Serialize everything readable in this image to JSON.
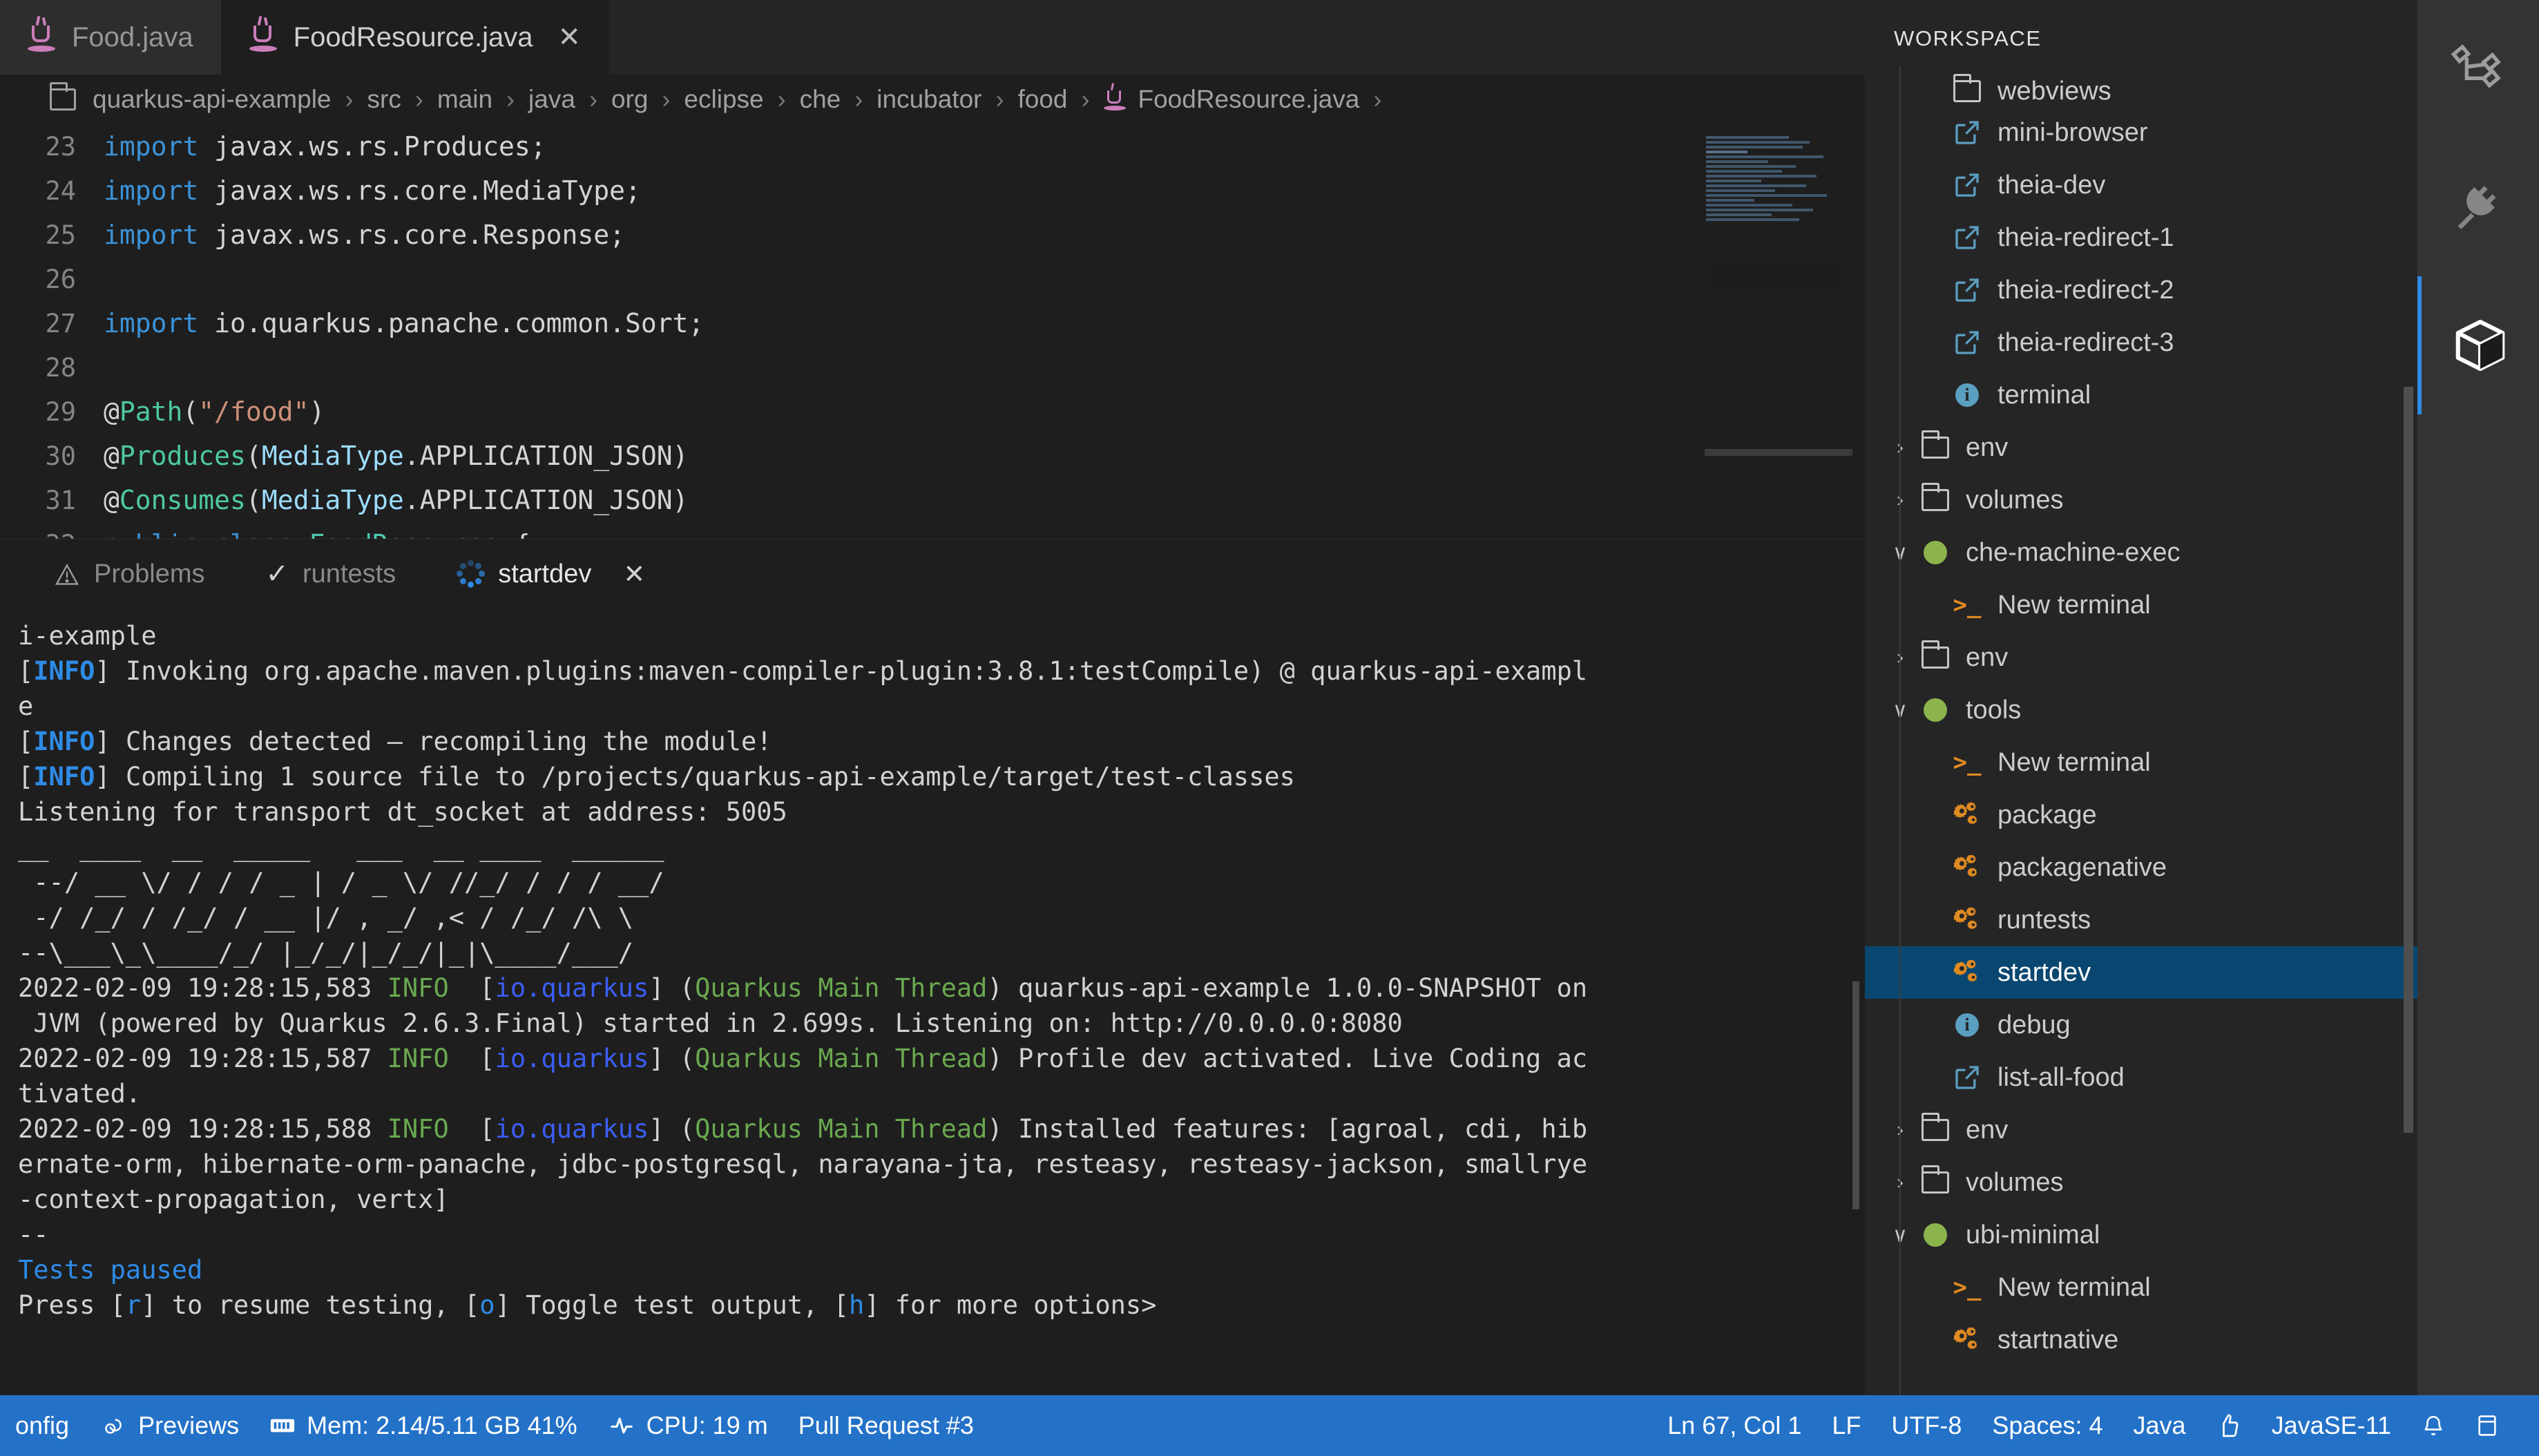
{
  "editor": {
    "tabs": [
      {
        "label": "Food.java",
        "icon": "java-icon",
        "active": false,
        "closable": false
      },
      {
        "label": "FoodResource.java",
        "icon": "java-icon",
        "active": true,
        "closable": true,
        "close_glyph": "✕"
      }
    ],
    "breadcrumb": {
      "folder_icon": "folder-icon",
      "separator": "›",
      "items": [
        "quarkus-api-example",
        "src",
        "main",
        "java",
        "org",
        "eclipse",
        "che",
        "incubator",
        "food"
      ],
      "file": "FoodResource.java",
      "file_icon": "java-icon",
      "trailing_separator": "›"
    },
    "code_lines": [
      {
        "num": "23",
        "tokens": [
          {
            "t": "import ",
            "c": "kw"
          },
          {
            "t": "javax.ws.rs.Produces;",
            "c": "plain"
          }
        ]
      },
      {
        "num": "24",
        "tokens": [
          {
            "t": "import ",
            "c": "kw"
          },
          {
            "t": "javax.ws.rs.core.MediaType;",
            "c": "plain"
          }
        ]
      },
      {
        "num": "25",
        "tokens": [
          {
            "t": "import ",
            "c": "kw"
          },
          {
            "t": "javax.ws.rs.core.Response;",
            "c": "plain"
          }
        ]
      },
      {
        "num": "26",
        "tokens": []
      },
      {
        "num": "27",
        "tokens": [
          {
            "t": "import ",
            "c": "kw"
          },
          {
            "t": "io.quarkus.panache.common.Sort;",
            "c": "plain"
          }
        ]
      },
      {
        "num": "28",
        "tokens": []
      },
      {
        "num": "29",
        "tokens": [
          {
            "t": "@",
            "c": "plain"
          },
          {
            "t": "Path",
            "c": "ann"
          },
          {
            "t": "(",
            "c": "plain"
          },
          {
            "t": "\"/food\"",
            "c": "str"
          },
          {
            "t": ")",
            "c": "plain"
          }
        ]
      },
      {
        "num": "30",
        "tokens": [
          {
            "t": "@",
            "c": "plain"
          },
          {
            "t": "Produces",
            "c": "ann"
          },
          {
            "t": "(",
            "c": "plain"
          },
          {
            "t": "MediaType",
            "c": "typ"
          },
          {
            "t": ".APPLICATION_JSON)",
            "c": "plain"
          }
        ]
      },
      {
        "num": "31",
        "tokens": [
          {
            "t": "@",
            "c": "plain"
          },
          {
            "t": "Consumes",
            "c": "ann"
          },
          {
            "t": "(",
            "c": "plain"
          },
          {
            "t": "MediaType",
            "c": "typ"
          },
          {
            "t": ".APPLICATION_JSON)",
            "c": "plain"
          }
        ]
      },
      {
        "num": "32",
        "tokens": [
          {
            "t": "public class ",
            "c": "kw"
          },
          {
            "t": "FoodResource",
            "c": "cls"
          },
          {
            "t": " {",
            "c": "plain"
          }
        ]
      }
    ]
  },
  "panel": {
    "tabs": [
      {
        "label": "Problems",
        "icon": "warning-triangle-icon",
        "selected": false
      },
      {
        "label": "runtests",
        "icon": "check-icon",
        "selected": false
      },
      {
        "label": "startdev",
        "icon": "spinner-icon",
        "selected": true,
        "close_glyph": "✕"
      }
    ],
    "terminal_lines": [
      [
        {
          "t": "i-example",
          "c": "plain"
        }
      ],
      [
        {
          "t": "[",
          "c": "plain"
        },
        {
          "t": "INFO",
          "c": "info"
        },
        {
          "t": "] Invoking org.apache.maven.plugins:maven-compiler-plugin:3.8.1:testCompile) @ quarkus-api-exampl",
          "c": "plain"
        }
      ],
      [
        {
          "t": "e",
          "c": "plain"
        }
      ],
      [
        {
          "t": "[",
          "c": "plain"
        },
        {
          "t": "INFO",
          "c": "info"
        },
        {
          "t": "] Changes detected – recompiling the module!",
          "c": "plain"
        }
      ],
      [
        {
          "t": "[",
          "c": "plain"
        },
        {
          "t": "INFO",
          "c": "info"
        },
        {
          "t": "] Compiling 1 source file to /projects/quarkus-api-example/target/test-classes",
          "c": "plain"
        }
      ],
      [
        {
          "t": "Listening for transport dt_socket at address: 5005",
          "c": "plain"
        }
      ],
      [
        {
          "t": "__  ____  __  _____   ___  __ ____  ______ ",
          "c": "plain"
        }
      ],
      [
        {
          "t": " --/ __ \\/ / / / _ | / _ \\/ //_/ / / / __/ ",
          "c": "plain"
        }
      ],
      [
        {
          "t": " -/ /_/ / /_/ / __ |/ , _/ ,< / /_/ /\\ \\   ",
          "c": "plain"
        }
      ],
      [
        {
          "t": "--\\___\\_\\____/_/ |_/_/|_/_/|_|\\____/___/   ",
          "c": "plain"
        }
      ],
      [
        {
          "t": "2022-02-09 19:28:15,583 ",
          "c": "plain"
        },
        {
          "t": "INFO",
          "c": "green"
        },
        {
          "t": "  [",
          "c": "plain"
        },
        {
          "t": "io.quarkus",
          "c": "blue"
        },
        {
          "t": "] (",
          "c": "plain"
        },
        {
          "t": "Quarkus Main Thread",
          "c": "green"
        },
        {
          "t": ") quarkus-api-example 1.0.0-SNAPSHOT on",
          "c": "plain"
        }
      ],
      [
        {
          "t": " JVM (powered by Quarkus 2.6.3.Final) started in 2.699s. Listening on: http://0.0.0.0:8080",
          "c": "plain"
        }
      ],
      [
        {
          "t": "",
          "c": "plain"
        }
      ],
      [
        {
          "t": "2022-02-09 19:28:15,587 ",
          "c": "plain"
        },
        {
          "t": "INFO",
          "c": "green"
        },
        {
          "t": "  [",
          "c": "plain"
        },
        {
          "t": "io.quarkus",
          "c": "blue"
        },
        {
          "t": "] (",
          "c": "plain"
        },
        {
          "t": "Quarkus Main Thread",
          "c": "green"
        },
        {
          "t": ") Profile dev activated. Live Coding ac",
          "c": "plain"
        }
      ],
      [
        {
          "t": "tivated.",
          "c": "plain"
        }
      ],
      [
        {
          "t": "2022-02-09 19:28:15,588 ",
          "c": "plain"
        },
        {
          "t": "INFO",
          "c": "green"
        },
        {
          "t": "  [",
          "c": "plain"
        },
        {
          "t": "io.quarkus",
          "c": "blue"
        },
        {
          "t": "] (",
          "c": "plain"
        },
        {
          "t": "Quarkus Main Thread",
          "c": "green"
        },
        {
          "t": ") Installed features: [agroal, cdi, hib",
          "c": "plain"
        }
      ],
      [
        {
          "t": "ernate-orm, hibernate-orm-panache, jdbc-postgresql, narayana-jta, resteasy, resteasy-jackson, smallrye",
          "c": "plain"
        }
      ],
      [
        {
          "t": "-context-propagation, vertx]",
          "c": "plain"
        }
      ],
      [
        {
          "t": "",
          "c": "plain"
        }
      ],
      [
        {
          "t": "--",
          "c": "plain"
        }
      ],
      [
        {
          "t": "Tests paused",
          "c": "ltblue"
        }
      ],
      [
        {
          "t": "Press [",
          "c": "plain"
        },
        {
          "t": "r",
          "c": "ltblue"
        },
        {
          "t": "] to resume testing, [",
          "c": "plain"
        },
        {
          "t": "o",
          "c": "ltblue"
        },
        {
          "t": "] Toggle test output, [",
          "c": "plain"
        },
        {
          "t": "h",
          "c": "ltblue"
        },
        {
          "t": "] for more options>",
          "c": "plain"
        }
      ]
    ]
  },
  "sidebar": {
    "title": "WORKSPACE",
    "items": [
      {
        "label": "webviews",
        "icon": "folder-icon",
        "indent": 2,
        "chevron": "",
        "clipped": true
      },
      {
        "label": "mini-browser",
        "icon": "link-icon",
        "indent": 2,
        "chevron": ""
      },
      {
        "label": "theia-dev",
        "icon": "link-icon",
        "indent": 2,
        "chevron": ""
      },
      {
        "label": "theia-redirect-1",
        "icon": "link-icon",
        "indent": 2,
        "chevron": ""
      },
      {
        "label": "theia-redirect-2",
        "icon": "link-icon",
        "indent": 2,
        "chevron": ""
      },
      {
        "label": "theia-redirect-3",
        "icon": "link-icon",
        "indent": 2,
        "chevron": ""
      },
      {
        "label": "terminal",
        "icon": "info-icon",
        "indent": 2,
        "chevron": ""
      },
      {
        "label": "env",
        "icon": "folder-icon",
        "indent": 1,
        "chevron": "›"
      },
      {
        "label": "volumes",
        "icon": "folder-icon",
        "indent": 1,
        "chevron": "›"
      },
      {
        "label": "che-machine-exec",
        "icon": "status-dot-green",
        "indent": 0,
        "chevron": "∨"
      },
      {
        "label": "New terminal",
        "icon": "terminal-icon",
        "indent": 2,
        "chevron": ""
      },
      {
        "label": "env",
        "icon": "folder-icon",
        "indent": 1,
        "chevron": "›"
      },
      {
        "label": "tools",
        "icon": "status-dot-green",
        "indent": 0,
        "chevron": "∨"
      },
      {
        "label": "New terminal",
        "icon": "terminal-icon",
        "indent": 2,
        "chevron": ""
      },
      {
        "label": "package",
        "icon": "gears-icon",
        "indent": 2,
        "chevron": ""
      },
      {
        "label": "packagenative",
        "icon": "gears-icon",
        "indent": 2,
        "chevron": ""
      },
      {
        "label": "runtests",
        "icon": "gears-icon",
        "indent": 2,
        "chevron": ""
      },
      {
        "label": "startdev",
        "icon": "gears-icon",
        "indent": 2,
        "chevron": "",
        "selected": true
      },
      {
        "label": "debug",
        "icon": "info-icon",
        "indent": 2,
        "chevron": ""
      },
      {
        "label": "list-all-food",
        "icon": "link-icon",
        "indent": 2,
        "chevron": ""
      },
      {
        "label": "env",
        "icon": "folder-icon",
        "indent": 1,
        "chevron": "›"
      },
      {
        "label": "volumes",
        "icon": "folder-icon",
        "indent": 1,
        "chevron": "›"
      },
      {
        "label": "ubi-minimal",
        "icon": "status-dot-green",
        "indent": 0,
        "chevron": "∨"
      },
      {
        "label": "New terminal",
        "icon": "terminal-icon",
        "indent": 2,
        "chevron": ""
      },
      {
        "label": "startnative",
        "icon": "gears-icon",
        "indent": 2,
        "chevron": ""
      }
    ]
  },
  "activity_bar": {
    "items": [
      {
        "name": "share-nodes-icon",
        "active": false
      },
      {
        "name": "plug-icon",
        "active": false
      },
      {
        "name": "cube-icon",
        "active": true
      }
    ]
  },
  "status_bar": {
    "left": [
      {
        "label": "onfig",
        "icon": ""
      },
      {
        "label": "Previews",
        "icon": "preview-icon"
      },
      {
        "label": "Mem: 2.14/5.11 GB 41%",
        "icon": "memory-icon"
      },
      {
        "label": "CPU: 19 m",
        "icon": "pulse-icon"
      },
      {
        "label": "Pull Request #3",
        "icon": ""
      }
    ],
    "right": [
      {
        "label": "Ln 67, Col 1",
        "icon": ""
      },
      {
        "label": "LF",
        "icon": ""
      },
      {
        "label": "UTF-8",
        "icon": ""
      },
      {
        "label": "Spaces: 4",
        "icon": ""
      },
      {
        "label": "Java",
        "icon": ""
      },
      {
        "label": "",
        "icon": "thumbs-up-icon"
      },
      {
        "label": "JavaSE-11",
        "icon": ""
      },
      {
        "label": "",
        "icon": "bell-icon"
      },
      {
        "label": "",
        "icon": "layout-icon"
      }
    ]
  },
  "colors": {
    "accent": "#2472c8",
    "selection": "#094771",
    "editor_bg": "#1e1e1e",
    "sidebar_bg": "#252526",
    "activity_bg": "#333333",
    "green_dot": "#8cb44c",
    "orange_icon": "#e08a21",
    "link_icon": "#5a9ec0"
  }
}
